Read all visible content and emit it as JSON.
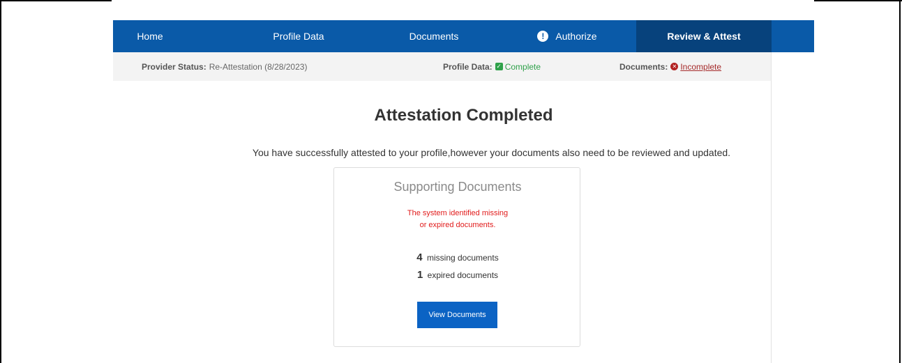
{
  "nav": {
    "home": "Home",
    "profile_data": "Profile Data",
    "documents": "Documents",
    "authorize": "Authorize",
    "authorize_icon": "exclamation-circle-icon",
    "review_attest": "Review & Attest"
  },
  "status": {
    "provider_label": "Provider Status:",
    "provider_value": "Re-Attestation (8/28/2023)",
    "profile_label": "Profile Data:",
    "profile_value": "Complete",
    "documents_label": "Documents:",
    "documents_value": "Incomplete"
  },
  "main": {
    "title": "Attestation Completed",
    "message": "You have successfully attested to your profile,however your documents also need to be reviewed and updated."
  },
  "card": {
    "title": "Supporting Documents",
    "warning_line1": "The system identified missing",
    "warning_line2": "or expired documents.",
    "missing_count": "4",
    "missing_label": "missing documents",
    "expired_count": "1",
    "expired_label": "expired documents",
    "button_label": "View Documents"
  },
  "colors": {
    "nav_bg": "#0a5aa8",
    "nav_active_bg": "#07427c",
    "complete": "#2fa14a",
    "incomplete": "#a52a2a",
    "warning_text": "#e11b1b",
    "button_bg": "#0b63c4"
  }
}
